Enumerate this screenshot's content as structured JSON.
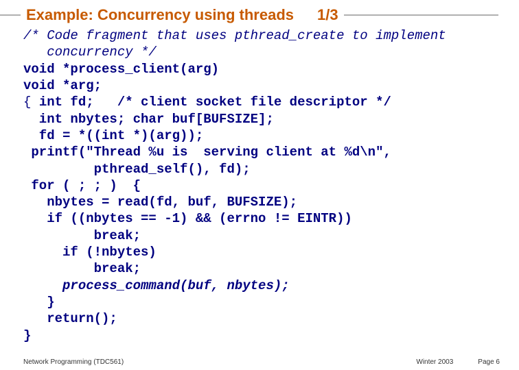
{
  "title": {
    "text": "Example: Concurrency using threads",
    "page": "1/3"
  },
  "code": {
    "l1": "/* Code fragment that uses pthread_create to implement",
    "l2": "   concurrency */",
    "l3": "void *process_client(arg)",
    "l4": "void *arg;",
    "l5a": "{ ",
    "l5b": "int fd;   /* client socket file descriptor */",
    "l6": "  int nbytes; char buf[BUFSIZE];",
    "l7": "  fd = *((int *)(arg));",
    "l8": " printf(\"Thread %u is  serving client at %d\\n\",",
    "l9": "         pthread_self(), fd);",
    "l10": " for ( ; ; )  {",
    "l11": "   nbytes = read(fd, buf, BUFSIZE);",
    "l12": "   if ((nbytes == -1) && (errno != EINTR))",
    "l13": "         break;",
    "l14": "     if (!nbytes)",
    "l15": "         break;",
    "l16a": "     ",
    "l16b": "process_command(buf, nbytes);",
    "l17": "   }",
    "l18": "   return();",
    "l19": "}"
  },
  "footer": {
    "left": "Network Programming (TDC561)",
    "center": "Winter 2003",
    "right": "Page 6"
  }
}
